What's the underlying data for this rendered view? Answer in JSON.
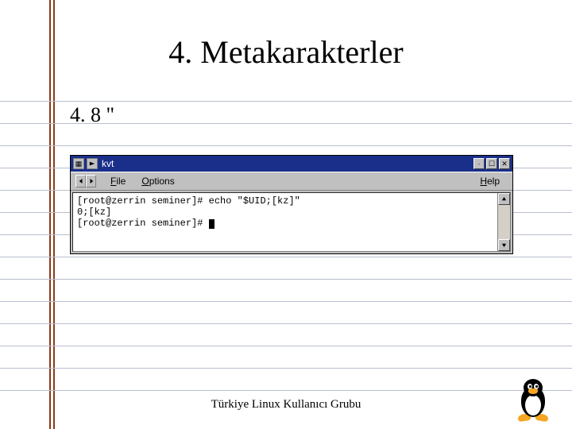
{
  "title": "4. Metakarakterler",
  "section": "4. 8  \"",
  "window": {
    "title": "kvt",
    "min_symbol": "·",
    "max_symbol": "☐",
    "close_symbol": "✕"
  },
  "menu": {
    "file": "File",
    "options": "Options",
    "help": "Help"
  },
  "terminal": {
    "line1": "[root@zerrin seminer]# echo \"$UID;[kz]\"",
    "line2": "0;[kz]",
    "line3": "[root@zerrin seminer]# "
  },
  "footer": "Türkiye Linux Kullanıcı Grubu"
}
